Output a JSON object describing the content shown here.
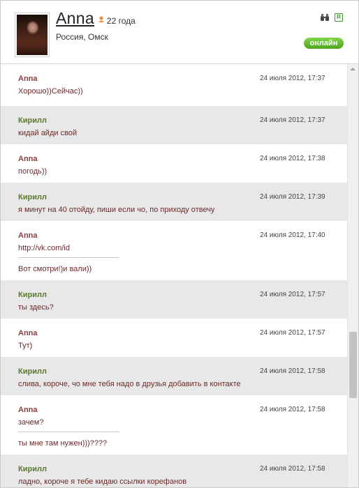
{
  "profile": {
    "name": "Anna",
    "age": "22 года",
    "location": "Россия, Омск",
    "status": "онлайн"
  },
  "messages": [
    {
      "author": "Anna",
      "time": "24 июля 2012, 17:37",
      "lines": [
        "Хорошо))Сейчас))"
      ]
    },
    {
      "author": "Кирилл",
      "time": "24 июля 2012, 17:37",
      "lines": [
        "кидай айди свой"
      ]
    },
    {
      "author": "Anna",
      "time": "24 июля 2012, 17:38",
      "lines": [
        "погодь))"
      ]
    },
    {
      "author": "Кирилл",
      "time": "24 июля 2012, 17:39",
      "lines": [
        "я минут на 40 отойду, пиши если чо, по приходу отвечу"
      ]
    },
    {
      "author": "Anna",
      "time": "24 июля 2012, 17:40",
      "lines": [
        "http://vk.com/id",
        "Вот смотри!)и вали))"
      ]
    },
    {
      "author": "Кирилл",
      "time": "24 июля 2012, 17:57",
      "lines": [
        "ты здесь?"
      ]
    },
    {
      "author": "Anna",
      "time": "24 июля 2012, 17:57",
      "lines": [
        "Тут)"
      ]
    },
    {
      "author": "Кирилл",
      "time": "24 июля 2012, 17:58",
      "lines": [
        "слива, короче, чо мне тебя надо в друзья добавить в контакте"
      ]
    },
    {
      "author": "Anna",
      "time": "24 июля 2012, 17:58",
      "lines": [
        "зачем?",
        "ты мне там нужен)))????"
      ]
    },
    {
      "author": "Кирилл",
      "time": "24 июля 2012, 17:58",
      "lines": [
        "ладно, короче я тебе кидаю ссылки корефанов"
      ]
    }
  ]
}
